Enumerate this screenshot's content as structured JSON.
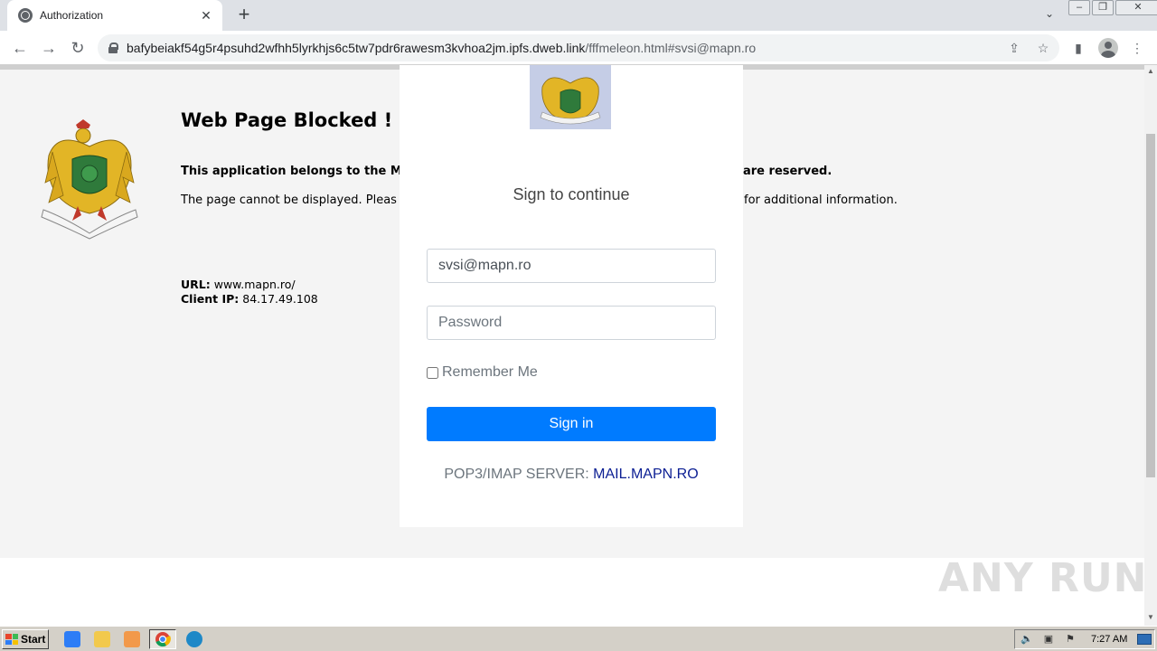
{
  "browser": {
    "tab_title": "Authorization",
    "tab_close": "✕",
    "new_tab": "+",
    "tab_search": "⌄",
    "url_host": "bafybeiakf54g5r4psuhd2wfhh5lyrkhjs6c5tw7pdr6rawesm3kvhoa2jm.ipfs.dweb.link",
    "url_path": "/fffmeleon.html#svsi@mapn.ro",
    "back": "←",
    "forward": "→",
    "reload": "↻",
    "share": "⇪",
    "star": "☆",
    "sidepanel": "▮",
    "menu": "⋮",
    "window_minimize": "–",
    "window_restore": "❐",
    "window_close": "✕"
  },
  "page": {
    "title": "Web Page Blocked ! !",
    "bold_line": "This application belongs to the Mi",
    "bold_line_tail": "are reserved.",
    "text_line": "The page cannot be displayed. Pleas",
    "text_line_tail": "for additional information.",
    "url_label": "URL:",
    "url_value": "www.mapn.ro/",
    "ip_label": "Client IP:",
    "ip_value": "84.17.49.108"
  },
  "modal": {
    "heading": "Sign to continue",
    "email_value": "svsi@mapn.ro",
    "password_placeholder": "Password",
    "remember_label": "Remember Me",
    "signin_label": "Sign in",
    "server_label": "POP3/IMAP SERVER:",
    "server_link": "MAIL.MAPN.RO"
  },
  "watermark": {
    "text": "ANY RUN"
  },
  "taskbar": {
    "start_label": "Start",
    "clock": "7:27 AM"
  },
  "colors": {
    "primary_button": "#007bff",
    "server_link": "#0b1e93"
  }
}
